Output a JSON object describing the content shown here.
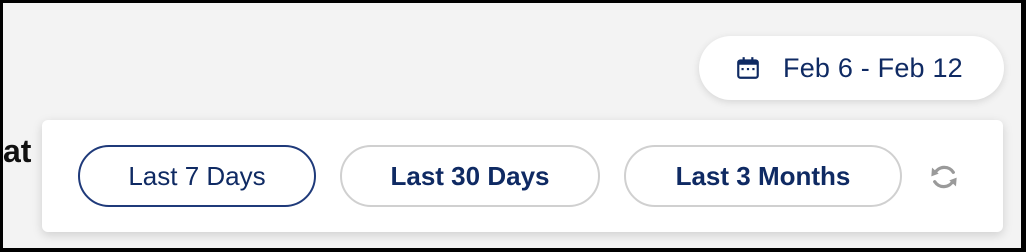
{
  "date_range": {
    "label": "Feb 6 - Feb 12",
    "icon": "calendar-icon"
  },
  "page_title_fragment": "at",
  "quick_ranges": [
    {
      "label": "Last 7 Days",
      "active": true
    },
    {
      "label": "Last 30 Days",
      "active": false
    },
    {
      "label": "Last 3 Months",
      "active": false
    }
  ],
  "refresh": {
    "icon": "refresh-icon"
  },
  "colors": {
    "primary_text": "#0f2a63",
    "active_border": "#1f3a7a",
    "inactive_border": "#d0d0d0",
    "background": "#f3f3f3",
    "icon_gray": "#9a9a9a"
  }
}
